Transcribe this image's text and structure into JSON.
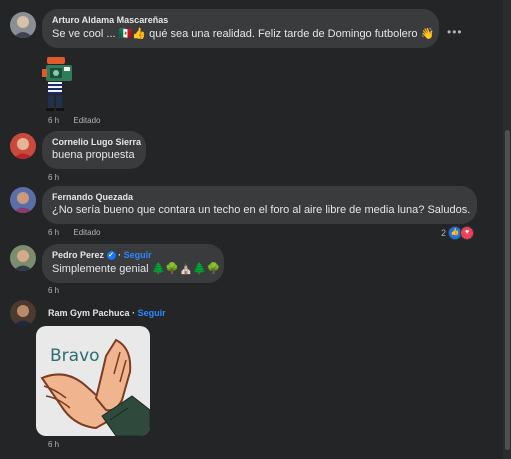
{
  "comments": [
    {
      "author": "Arturo Aldama Mascareñas",
      "text": "Se ve cool ... 🇲🇽👍 qué sea una realidad. Feliz tarde de Domingo futbolero 👋",
      "time": "6 h",
      "edited": "Editado",
      "more_icon": "more-horizontal-icon",
      "sticker": "photographer-sticker"
    },
    {
      "author": "Cornelio Lugo Sierra",
      "text": "buena propuesta",
      "time": "6 h"
    },
    {
      "author": "Fernando Quezada",
      "text": "¿No sería bueno que contara un techo en el foro al aire libre de media luna? Saludos.",
      "time": "6 h",
      "edited": "Editado",
      "reaction_count": "2",
      "reaction_icons": [
        "like-icon",
        "love-icon"
      ]
    },
    {
      "author": "Pedro Perez",
      "follow": "Seguir",
      "text": "Simplemente genial 🌲🌳⛪🌲🌳",
      "time": "6 h",
      "verified_icon": "verified-badge-icon"
    },
    {
      "author": "Ram Gym Pachuca",
      "follow": "Seguir",
      "time": "6 h",
      "sticker_text": "Bravo",
      "sticker": "clapping-hands-sticker"
    }
  ],
  "colors": {
    "background": "#242526",
    "bubble": "#3a3b3c",
    "text": "#e4e6eb",
    "secondary": "#b0b3b8",
    "link": "#2d88ff"
  }
}
